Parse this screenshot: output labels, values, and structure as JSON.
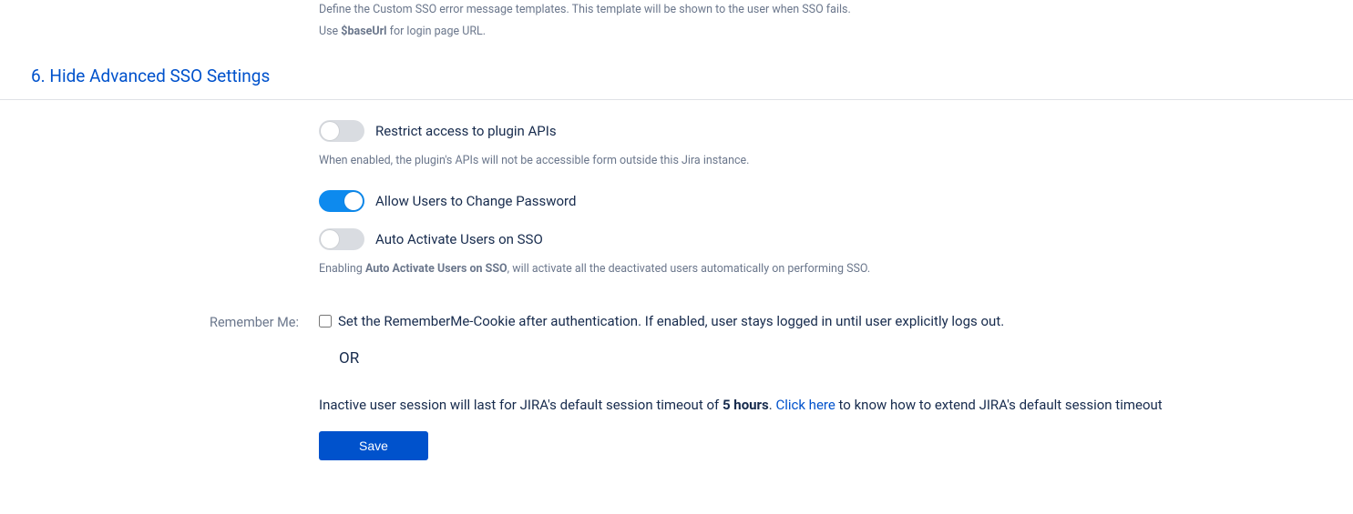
{
  "intro": {
    "line1": "Define the Custom SSO error message templates. This template will be shown to the user when SSO fails.",
    "line2_prefix": "Use ",
    "line2_bold": "$baseUrl",
    "line2_suffix": " for login page URL."
  },
  "section": {
    "title": "6. Hide Advanced SSO Settings"
  },
  "toggles": {
    "restrict": {
      "label": "Restrict access to plugin APIs",
      "on": false
    },
    "restrict_help": "When enabled, the plugin's APIs will not be accessible form outside this Jira instance.",
    "password": {
      "label": "Allow Users to Change Password",
      "on": true
    },
    "activate": {
      "label": "Auto Activate Users on SSO",
      "on": false
    },
    "activate_help_prefix": "Enabling ",
    "activate_help_bold": "Auto Activate Users on SSO",
    "activate_help_suffix": ", will activate all the deactivated users automatically on performing SSO."
  },
  "remember": {
    "label": "Remember Me:",
    "checkbox_text": "Set the RememberMe-Cookie after authentication. If enabled, user stays logged in until user explicitly logs out.",
    "or": "OR"
  },
  "session": {
    "prefix": "Inactive user session will last for JIRA's default session timeout of ",
    "bold": "5 hours",
    "mid": ". ",
    "link": "Click here",
    "suffix": " to know how to extend JIRA's default session timeout"
  },
  "buttons": {
    "save": "Save"
  }
}
